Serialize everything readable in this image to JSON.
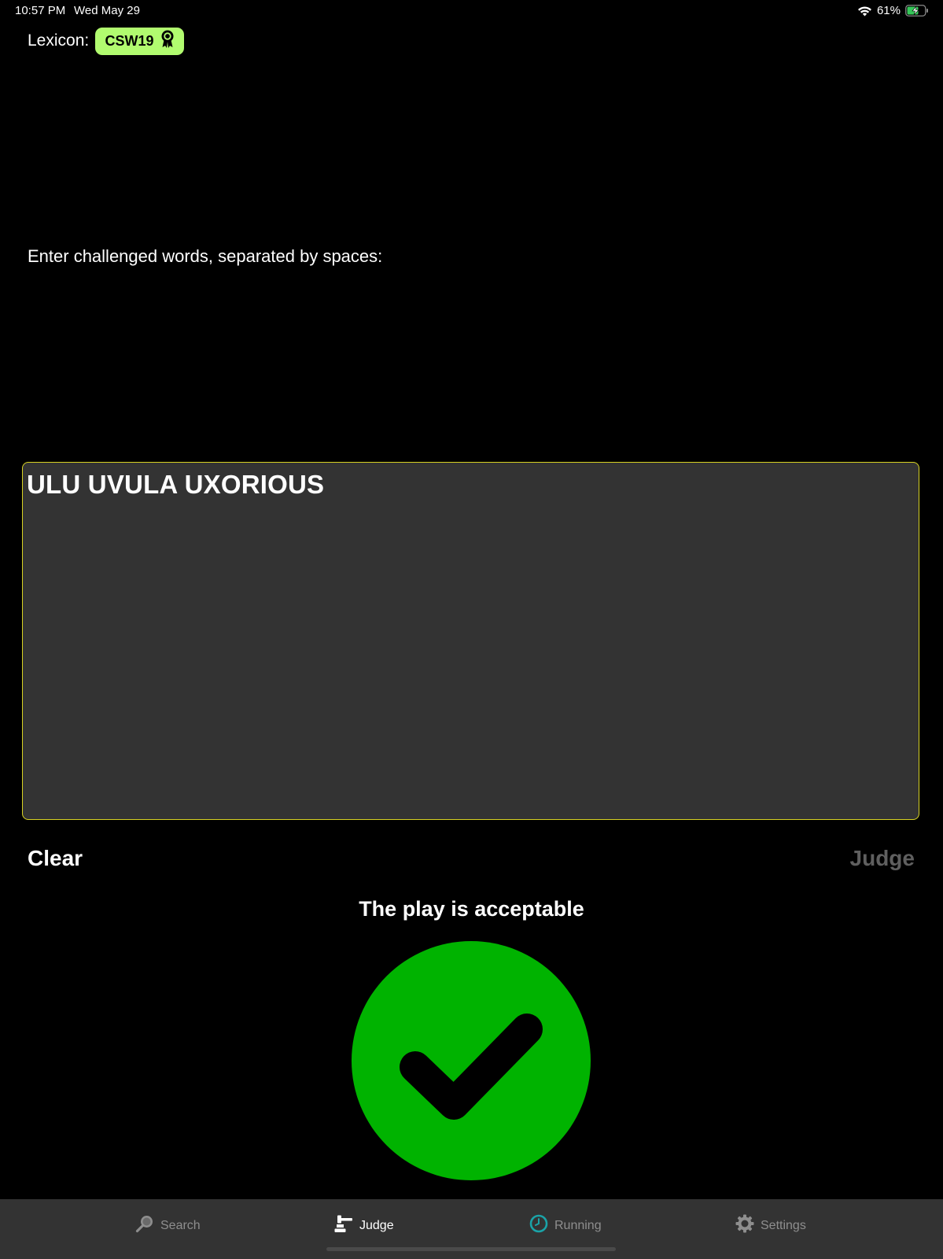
{
  "status": {
    "time": "10:57 PM",
    "date": "Wed May 29",
    "battery": "61%"
  },
  "lexicon": {
    "label": "Lexicon:",
    "value": "CSW19"
  },
  "prompt": "Enter challenged words, separated by spaces:",
  "words_input": {
    "value": "ULU UVULA UXORIOUS"
  },
  "actions": {
    "clear": "Clear",
    "judge": "Judge"
  },
  "result": {
    "text": "The play is acceptable",
    "status": "acceptable",
    "color": "#00b300"
  },
  "tabs": [
    {
      "label": "Search",
      "icon": "search-icon",
      "active": false
    },
    {
      "label": "Judge",
      "icon": "gavel-icon",
      "active": true
    },
    {
      "label": "Running",
      "icon": "clock-icon",
      "active": false
    },
    {
      "label": "Settings",
      "icon": "gear-icon",
      "active": false
    }
  ],
  "colors": {
    "accent": "#b1fb6f",
    "box_border": "#d8d323",
    "success": "#00b300",
    "tab_bar": "#333333",
    "running_icon": "#1aa3a8"
  }
}
